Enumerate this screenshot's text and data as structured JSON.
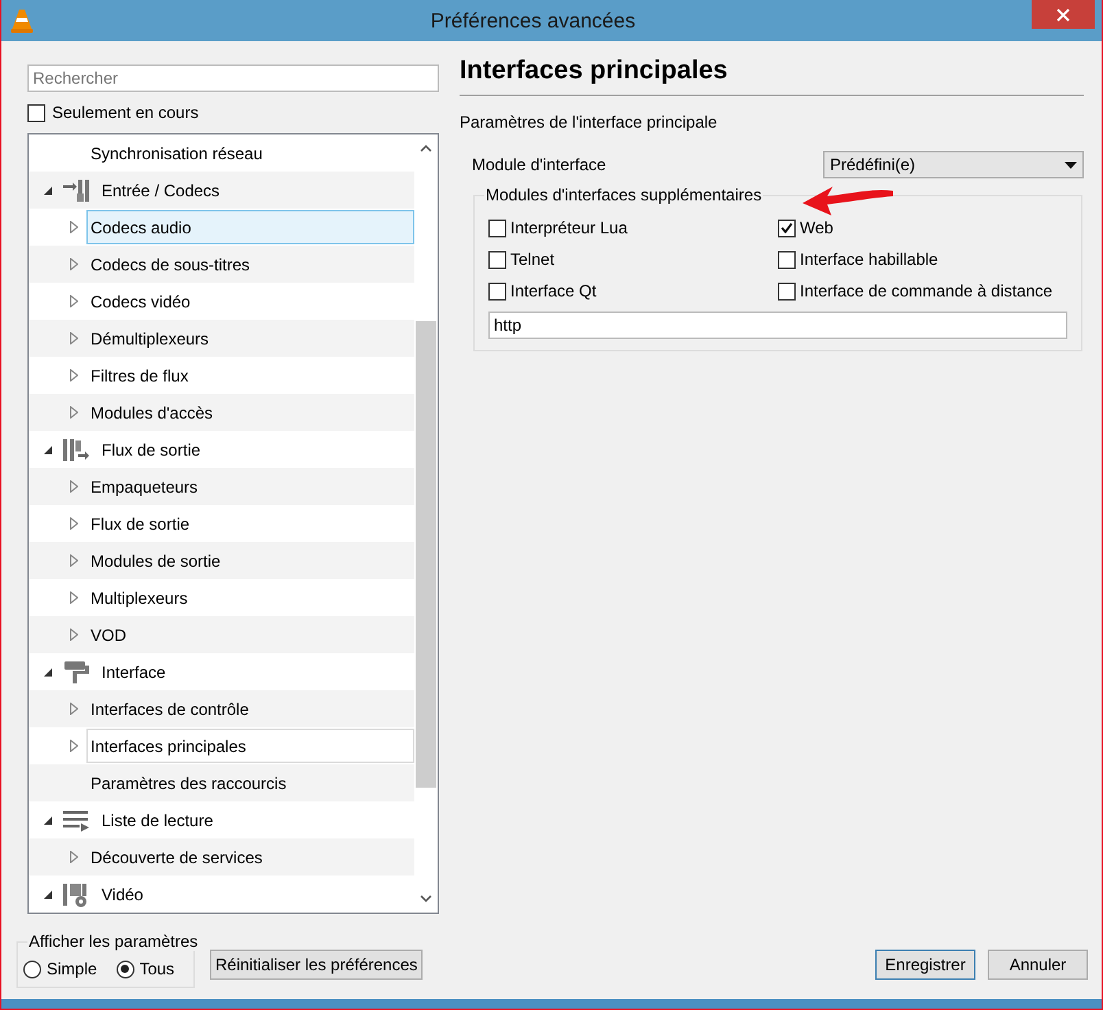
{
  "window": {
    "title": "Préférences avancées"
  },
  "search": {
    "placeholder": "Rechercher"
  },
  "only_current": {
    "label": "Seulement en cours",
    "checked": false
  },
  "tree": {
    "continued_children": [
      {
        "label": "Synchronisation réseau",
        "has_children": false,
        "selected": false,
        "current": false
      }
    ],
    "items": [
      {
        "label": "Entrée / Codecs",
        "expanded": true,
        "children": [
          {
            "label": "Codecs audio",
            "has_children": true,
            "selected": true,
            "current": false
          },
          {
            "label": "Codecs de sous-titres",
            "has_children": true,
            "selected": false,
            "current": false
          },
          {
            "label": "Codecs vidéo",
            "has_children": true,
            "selected": false,
            "current": false
          },
          {
            "label": "Démultiplexeurs",
            "has_children": true,
            "selected": false,
            "current": false
          },
          {
            "label": "Filtres de flux",
            "has_children": true,
            "selected": false,
            "current": false
          },
          {
            "label": "Modules d'accès",
            "has_children": true,
            "selected": false,
            "current": false
          }
        ]
      },
      {
        "label": "Flux de sortie",
        "expanded": true,
        "children": [
          {
            "label": "Empaqueteurs",
            "has_children": true,
            "selected": false,
            "current": false
          },
          {
            "label": "Flux de sortie",
            "has_children": true,
            "selected": false,
            "current": false
          },
          {
            "label": "Modules de sortie",
            "has_children": true,
            "selected": false,
            "current": false
          },
          {
            "label": "Multiplexeurs",
            "has_children": true,
            "selected": false,
            "current": false
          },
          {
            "label": "VOD",
            "has_children": true,
            "selected": false,
            "current": false
          }
        ]
      },
      {
        "label": "Interface",
        "expanded": true,
        "children": [
          {
            "label": "Interfaces de contrôle",
            "has_children": true,
            "selected": false,
            "current": false
          },
          {
            "label": "Interfaces principales",
            "has_children": true,
            "selected": false,
            "current": true
          },
          {
            "label": "Paramètres des raccourcis",
            "has_children": false,
            "selected": false,
            "current": false
          }
        ]
      },
      {
        "label": "Liste de lecture",
        "expanded": true,
        "children": [
          {
            "label": "Découverte de services",
            "has_children": true,
            "selected": false,
            "current": false
          }
        ]
      },
      {
        "label": "Vidéo",
        "expanded": true
      }
    ]
  },
  "panel": {
    "title": "Interfaces principales",
    "subtitle": "Paramètres de l'interface principale",
    "module": {
      "label": "Module d'interface",
      "value": "Prédéfini(e)"
    },
    "extra_modules": {
      "title": "Modules d'interfaces supplémentaires",
      "options": [
        {
          "label": "Interpréteur Lua",
          "checked": false
        },
        {
          "label": "Web",
          "checked": true
        },
        {
          "label": "Telnet",
          "checked": false
        },
        {
          "label": "Interface habillable",
          "checked": false
        },
        {
          "label": "Interface Qt",
          "checked": false
        },
        {
          "label": "Interface de commande à distance",
          "checked": false
        }
      ],
      "value": "http"
    }
  },
  "show_settings": {
    "title": "Afficher les paramètres",
    "options": [
      {
        "label": "Simple",
        "selected": false
      },
      {
        "label": "Tous",
        "selected": true
      }
    ]
  },
  "reset_button": "Réinitialiser les préférences",
  "buttons": [
    {
      "label": "Enregistrer",
      "default": true
    },
    {
      "label": "Annuler",
      "default": false
    }
  ]
}
